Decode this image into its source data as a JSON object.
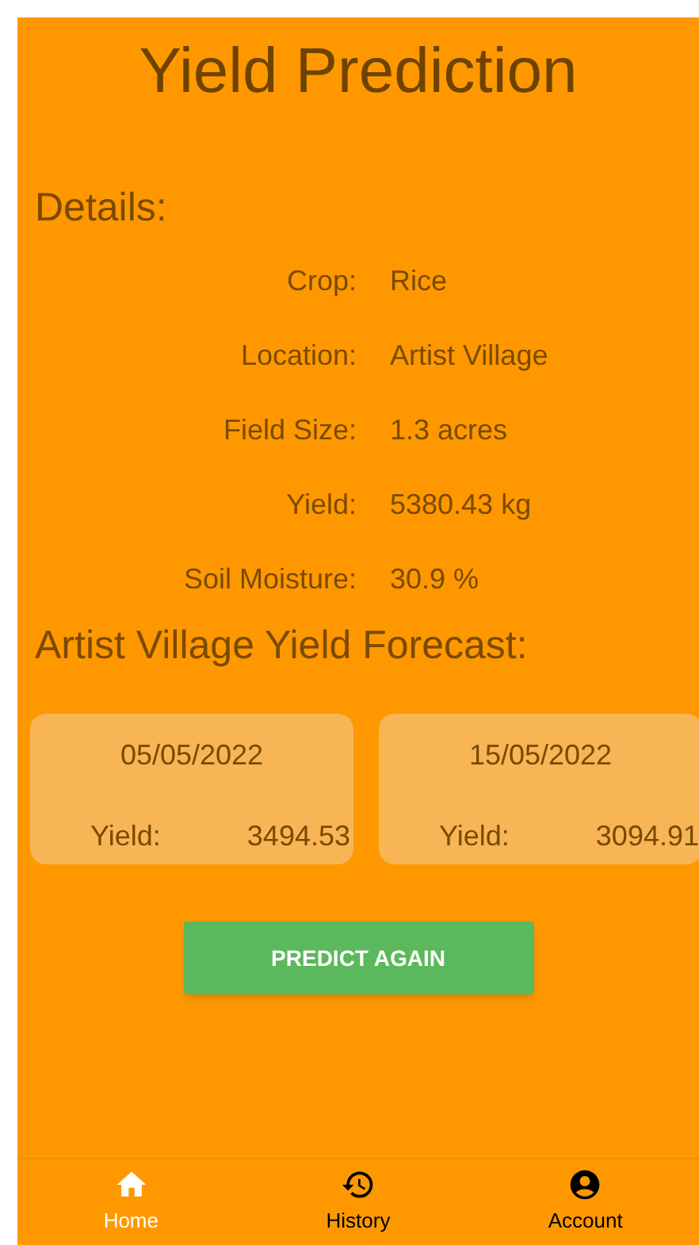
{
  "title": "Yield Prediction",
  "details_heading": "Details:",
  "details": [
    {
      "label": "Crop:",
      "value": "Rice"
    },
    {
      "label": "Location:",
      "value": "Artist Village"
    },
    {
      "label": "Field Size:",
      "value": "1.3 acres"
    },
    {
      "label": "Yield:",
      "value": "5380.43 kg"
    },
    {
      "label": "Soil Moisture:",
      "value": "30.9 %"
    }
  ],
  "forecast_heading": "Artist Village Yield Forecast:",
  "forecast": [
    {
      "date": "05/05/2022",
      "label": "Yield:",
      "value": "3494.53"
    },
    {
      "date": "15/05/2022",
      "label": "Yield:",
      "value": "3094.91"
    }
  ],
  "button": "PREDICT AGAIN",
  "nav": [
    {
      "kind": "home",
      "label": "Home",
      "selected": true
    },
    {
      "kind": "history",
      "label": "History",
      "selected": false
    },
    {
      "kind": "account",
      "label": "Account",
      "selected": false
    }
  ]
}
